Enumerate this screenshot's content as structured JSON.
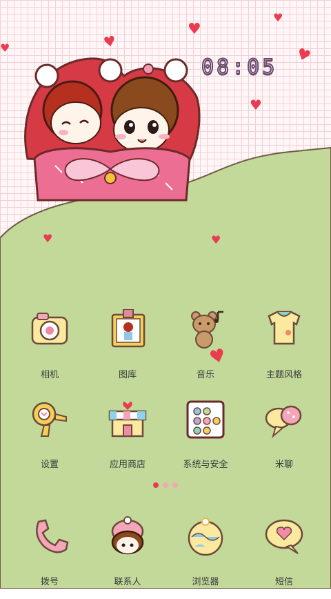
{
  "status": {
    "clock": "08:05"
  },
  "apps": [
    {
      "label": "相机",
      "icon": "camera-icon"
    },
    {
      "label": "图库",
      "icon": "gallery-icon"
    },
    {
      "label": "音乐",
      "icon": "music-bear-icon"
    },
    {
      "label": "主题风格",
      "icon": "theme-dress-icon"
    },
    {
      "label": "设置",
      "icon": "settings-hairdryer-icon"
    },
    {
      "label": "应用商店",
      "icon": "store-icon"
    },
    {
      "label": "系统与安全",
      "icon": "security-icon"
    },
    {
      "label": "米聊",
      "icon": "chat-bubbles-icon"
    }
  ],
  "dock": [
    {
      "label": "拨号",
      "icon": "phone-icon"
    },
    {
      "label": "联系人",
      "icon": "contacts-girl-icon"
    },
    {
      "label": "浏览器",
      "icon": "browser-globe-icon"
    },
    {
      "label": "短信",
      "icon": "message-heart-icon"
    }
  ],
  "page_indicator": {
    "pages": 3,
    "current": 1
  },
  "colors": {
    "grass": "#c2d99a",
    "heart": "#ec3b4f",
    "grid": "#f4cfd6"
  }
}
